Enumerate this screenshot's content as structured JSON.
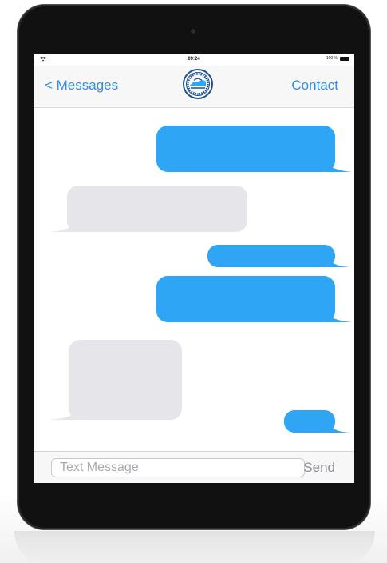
{
  "status_bar": {
    "time": "09:24",
    "battery": "100 %",
    "battery_level": 1.0,
    "wifi_icon": "wifi-icon"
  },
  "nav": {
    "back_label": "< Messages",
    "contact_label": "Contact",
    "avatar_icon": "university-seal-icon"
  },
  "conversation": {
    "messages": [
      {
        "sender": "me",
        "text": ""
      },
      {
        "sender": "them",
        "text": ""
      },
      {
        "sender": "me",
        "text": ""
      },
      {
        "sender": "me",
        "text": ""
      },
      {
        "sender": "them",
        "text": ""
      },
      {
        "sender": "me",
        "text": ""
      }
    ]
  },
  "composer": {
    "placeholder": "Text Message",
    "value": "",
    "send_label": "Send"
  },
  "colors": {
    "sent_bubble": "#2fa6f5",
    "received_bubble": "#e5e5ea",
    "accent": "#2f8fe4",
    "send_disabled": "#8e8e93"
  }
}
